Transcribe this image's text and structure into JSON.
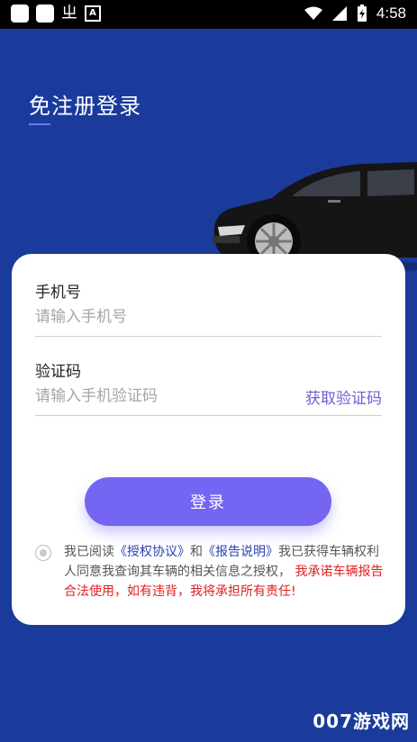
{
  "status_bar": {
    "time": "4:58"
  },
  "page": {
    "title": "免注册登录"
  },
  "form": {
    "phone_label": "手机号",
    "phone_placeholder": "请输入手机号",
    "code_label": "验证码",
    "code_placeholder": "请输入手机验证码",
    "get_code": "获取验证码",
    "login": "登录"
  },
  "agreement": {
    "prefix": "我已阅读",
    "link_auth": "《授权协议》",
    "and": "和",
    "link_report": "《报告说明》",
    "body": "我已获得车辆权利人同意我查询其车辆的相关信息之授权，",
    "warning": "我承诺车辆报告合法使用，如有违背，我将承担所有责任!"
  },
  "watermark": "007游戏网",
  "colors": {
    "background": "#1a3b9c",
    "accent": "#7465f3",
    "link": "#2c3fb0",
    "warning": "#e02020"
  }
}
